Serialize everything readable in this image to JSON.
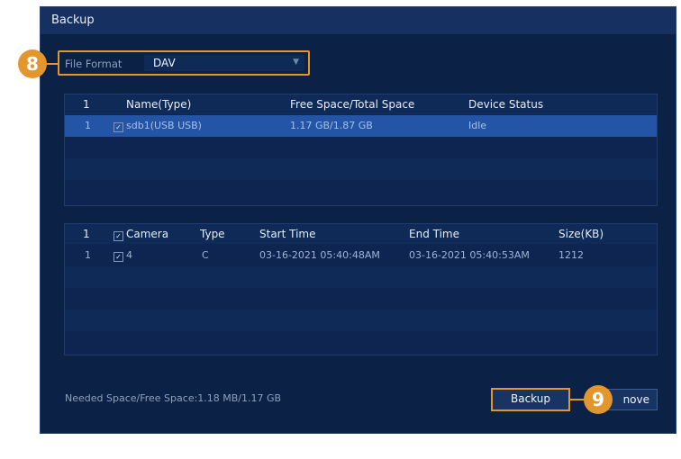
{
  "window": {
    "title": "Backup"
  },
  "annotations": {
    "step_8": "8",
    "step_9": "9"
  },
  "format": {
    "label": "File Format",
    "value": "DAV"
  },
  "devices": {
    "headers": {
      "index": "1",
      "name": "Name(Type)",
      "space": "Free Space/Total Space",
      "status": "Device Status"
    },
    "rows": [
      {
        "index": "1",
        "name": "sdb1(USB USB)",
        "space": "1.17 GB/1.87 GB",
        "status": "Idle"
      }
    ]
  },
  "files": {
    "headers": {
      "index": "1",
      "camera": "Camera",
      "type": "Type",
      "start": "Start Time",
      "end": "End Time",
      "size": "Size(KB)"
    },
    "rows": [
      {
        "index": "1",
        "camera": "4",
        "type": "C",
        "start": "03-16-2021 05:40:48AM",
        "end": "03-16-2021 05:40:53AM",
        "size": "1212"
      }
    ]
  },
  "footer": {
    "needed": "Needed Space/Free Space:1.18 MB/1.17 GB"
  },
  "buttons": {
    "backup": "Backup",
    "remove": "nove"
  },
  "colors": {
    "accent": "#e4962e",
    "panel": "#0c2146",
    "selected_row": "#2354a6"
  }
}
